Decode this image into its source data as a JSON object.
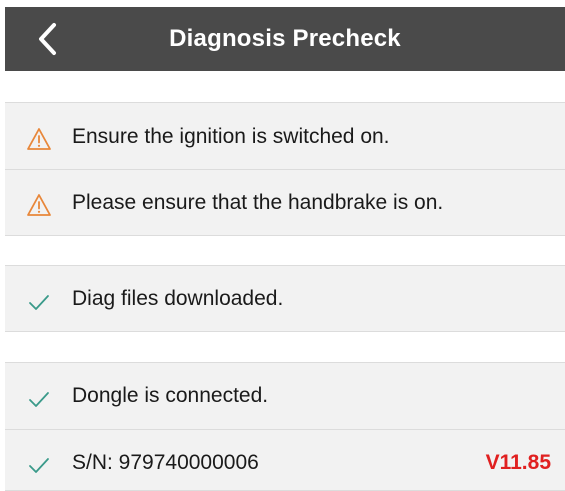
{
  "header": {
    "title": "Diagnosis Precheck",
    "back_icon": "chevron-left-icon"
  },
  "colors": {
    "header_bg": "#4a4a4a",
    "warning": "#e8873a",
    "check": "#3a9a8a",
    "version": "#e02020"
  },
  "checks": [
    {
      "status": "warning",
      "icon": "warning-icon",
      "label": "Ensure the ignition is switched on."
    },
    {
      "status": "warning",
      "icon": "warning-icon",
      "label": "Please ensure that the handbrake is on."
    },
    {
      "status": "ok",
      "icon": "check-icon",
      "label": "Diag files downloaded."
    },
    {
      "status": "ok",
      "icon": "check-icon",
      "label": "Dongle is connected."
    },
    {
      "status": "ok",
      "icon": "check-icon",
      "label": "S/N: 979740000006",
      "version": "V11.85"
    }
  ]
}
